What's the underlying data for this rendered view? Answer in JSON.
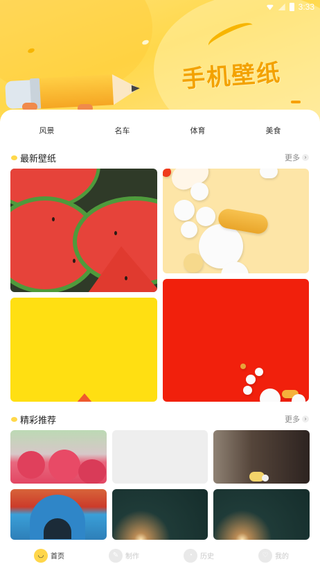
{
  "status_bar": {
    "time": "3:33"
  },
  "header": {
    "title": "手机壁纸"
  },
  "tabs": [
    {
      "label": "风景"
    },
    {
      "label": "名车"
    },
    {
      "label": "体育"
    },
    {
      "label": "美食"
    }
  ],
  "latest": {
    "title": "最新壁纸",
    "more": "更多",
    "arrow": "›"
  },
  "featured": {
    "title": "精彩推荐",
    "more": "更多",
    "arrow": "›"
  },
  "nav": [
    {
      "label": "首页",
      "icon": "home-icon",
      "active": true
    },
    {
      "label": "制作",
      "icon": "edit-icon",
      "active": false
    },
    {
      "label": "历史",
      "icon": "clock-icon",
      "active": false
    },
    {
      "label": "我的",
      "icon": "user-icon",
      "active": false
    }
  ],
  "colors": {
    "accent": "#ffd64a",
    "header": "#ffd84a"
  }
}
